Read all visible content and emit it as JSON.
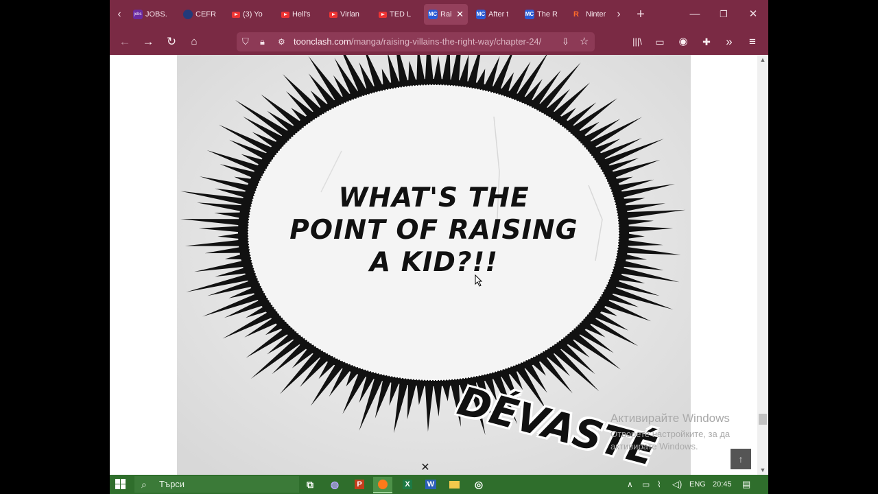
{
  "browser": {
    "tabs": [
      {
        "label": "JOBS.",
        "icon": "jobs-favicon",
        "kind": "jobs"
      },
      {
        "label": "CEFR",
        "icon": "cefr-favicon",
        "kind": "cefr"
      },
      {
        "label": "(3) Yo",
        "icon": "youtube-favicon",
        "kind": "yt"
      },
      {
        "label": "Hell's",
        "icon": "youtube-favicon",
        "kind": "yt"
      },
      {
        "label": "Virlan",
        "icon": "youtube-favicon",
        "kind": "yt"
      },
      {
        "label": "TED L",
        "icon": "youtube-favicon",
        "kind": "yt"
      },
      {
        "label": "Rai",
        "icon": "toonclash-favicon",
        "kind": "tc",
        "active": true
      },
      {
        "label": "After t",
        "icon": "toonclash-favicon",
        "kind": "tc"
      },
      {
        "label": "The R",
        "icon": "toonclash-favicon",
        "kind": "tc"
      },
      {
        "label": "Ninter",
        "icon": "nintendo-favicon",
        "kind": "nin"
      }
    ],
    "url_domain": "toonclash.com",
    "url_path": "/manga/raising-villains-the-right-way/chapter-24/"
  },
  "page": {
    "panel_text": "WHAT'S THE\nPOINT OF RAISING\nA KID?!!",
    "sfx_text": "DÉVASTÉ",
    "watermark_line1": "Активирайте Windows",
    "watermark_line2": "Отворете настройките, за да активирате Windows."
  },
  "taskbar": {
    "search_placeholder": "Търси",
    "language": "ENG",
    "time": "20:45"
  },
  "colors": {
    "browser_chrome": "#7a2a44",
    "taskbar": "#2f6e2c"
  }
}
